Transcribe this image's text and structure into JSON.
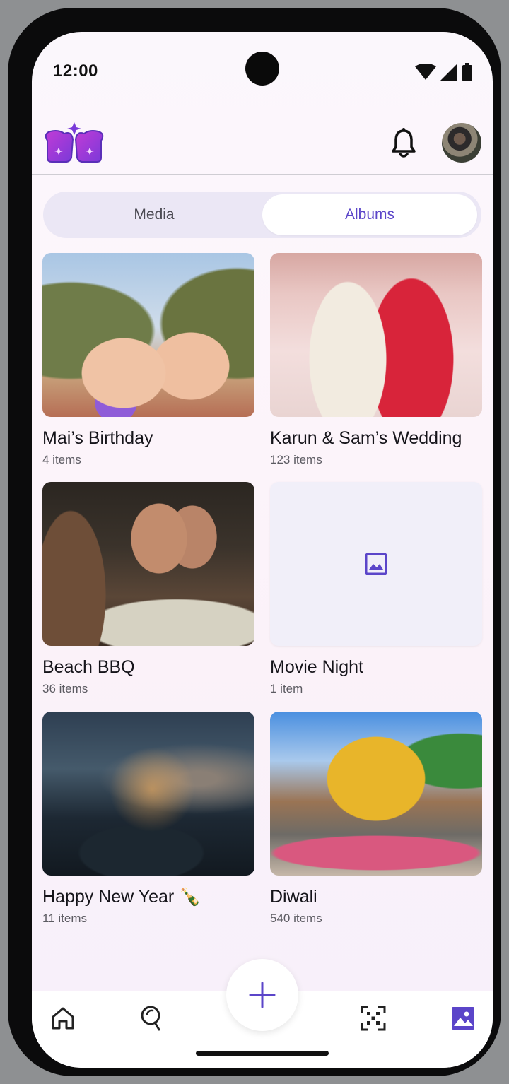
{
  "status_bar": {
    "time": "12:00"
  },
  "header": {
    "logo_icon": "crown-toast-logo",
    "notification_icon": "bell-icon",
    "avatar": "user-avatar"
  },
  "tabs": {
    "media": "Media",
    "albums": "Albums",
    "selected": "Albums"
  },
  "albums": [
    {
      "title": "Mai’s Birthday",
      "count": "4 items"
    },
    {
      "title": "Karun & Sam’s Wedding",
      "count": "123 items"
    },
    {
      "title": "Beach BBQ",
      "count": "36 items"
    },
    {
      "title": "Movie Night",
      "count": "1 item"
    },
    {
      "title": "Happy New Year 🍾",
      "count": "11 items"
    },
    {
      "title": "Diwali",
      "count": "540 items"
    }
  ],
  "bottom_nav": {
    "items": [
      "home-icon",
      "explore-icon",
      "add-icon",
      "scan-icon",
      "albums-icon"
    ],
    "active": "albums-icon"
  },
  "colors": {
    "accent": "#5b45c9",
    "logo_gradient": [
      "#b23ad6",
      "#6c3fd8"
    ]
  }
}
